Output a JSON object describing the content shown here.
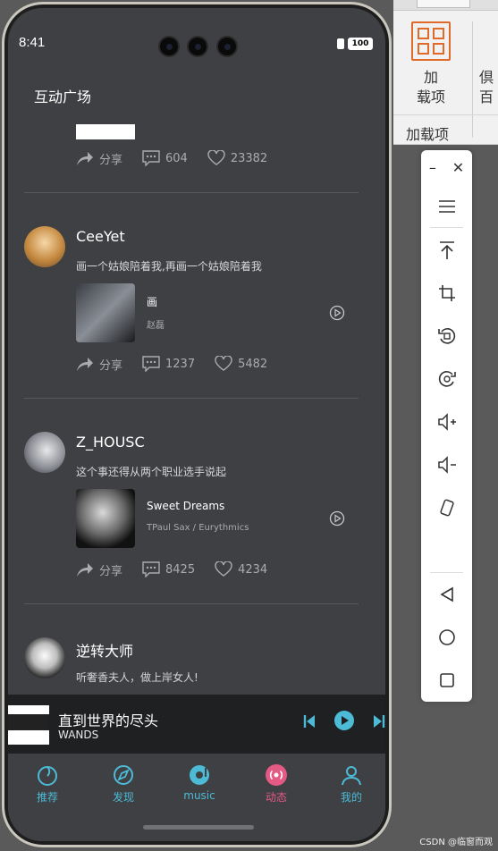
{
  "status": {
    "time": "8:41",
    "battery": "100"
  },
  "page_title": "互动广场",
  "first_post_actions": {
    "share": "分享",
    "comments": "604",
    "likes": "23382"
  },
  "posts": [
    {
      "user": "CeeYet",
      "text": "画一个姑娘陪着我,再画一个姑娘陪着我",
      "song": {
        "title": "画",
        "artist": "赵磊"
      },
      "share": "分享",
      "comments": "1237",
      "likes": "5482"
    },
    {
      "user": "Z_HOUSC",
      "text": "这个事还得从两个职业选手说起",
      "song": {
        "title": "Sweet Dreams",
        "artist": "TPaul Sax / Eurythmics"
      },
      "share": "分享",
      "comments": "8425",
      "likes": "4234"
    },
    {
      "user": "逆转大师",
      "text": "听奢香夫人，做上岸女人!"
    }
  ],
  "player": {
    "title": "直到世界的尽头",
    "artist": "WANDS"
  },
  "tabs": [
    "推荐",
    "发现",
    "music",
    "动态",
    "我的"
  ],
  "colors": {
    "accent": "#4dbad6",
    "active": "#e55a85",
    "bg": "#3e4043"
  },
  "desktop": {
    "ribbon_button": "加\n载项",
    "ribbon_button_short1": "加",
    "ribbon_button_short2": "载项",
    "ribbon_next_1": "倶",
    "ribbon_next_2": "百",
    "ribbon_group": "加载项"
  },
  "watermark": "CSDN @临窗而观"
}
